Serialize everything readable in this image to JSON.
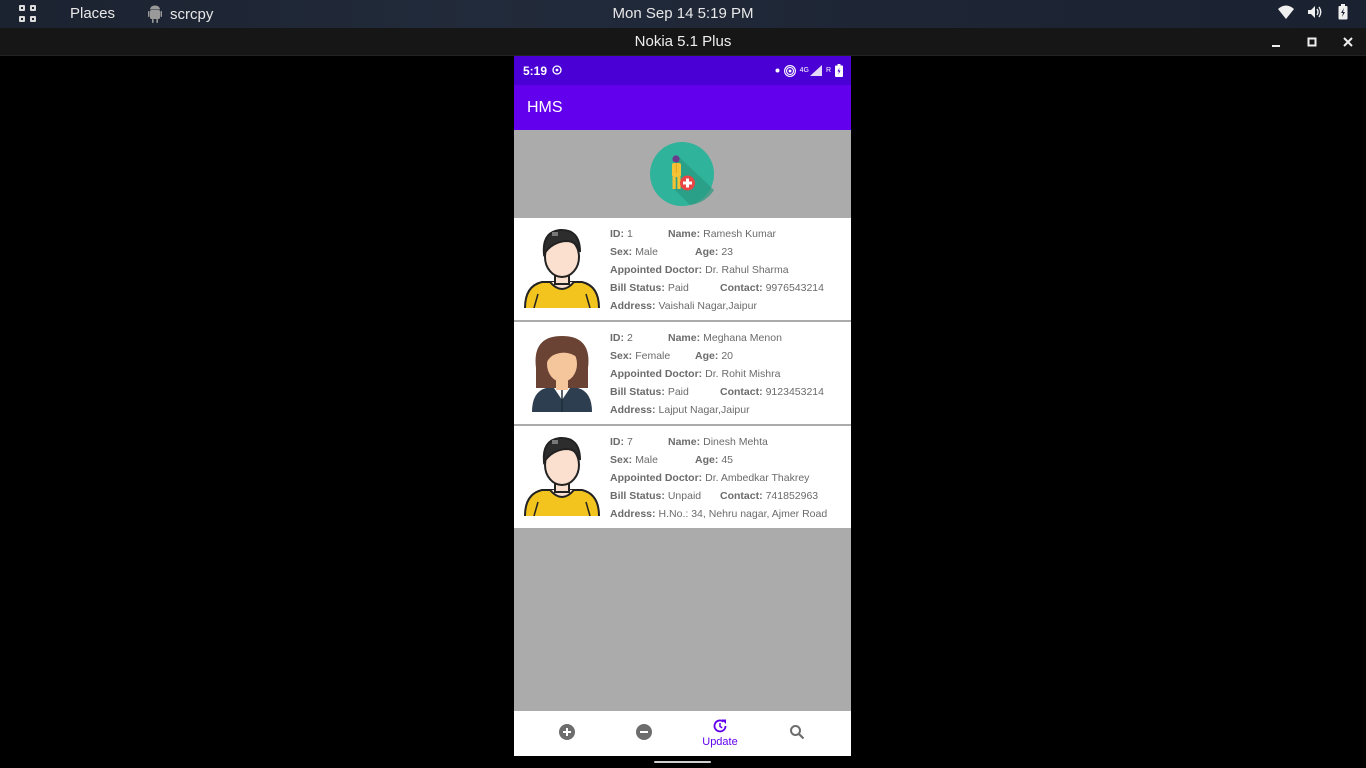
{
  "topbar": {
    "activities_icon": "apps-grid-icon",
    "places": "Places",
    "app_name": "scrcpy",
    "clock": "Mon Sep 14   5:19 PM",
    "tray_icons": [
      "wifi-icon",
      "volume-icon",
      "battery-icon"
    ]
  },
  "window": {
    "title": "Nokia 5.1 Plus",
    "buttons": [
      "minimize-icon",
      "maximize-icon",
      "close-icon"
    ]
  },
  "phone": {
    "status_time": "5:19",
    "status_network": "4G",
    "status_carrier": "R",
    "app_title": "HMS",
    "colors": {
      "status_bar": "#4a00d4",
      "app_bar": "#6200ee",
      "background": "#ababab",
      "accent": "#6200ee"
    }
  },
  "labels": {
    "id": "ID:",
    "name": "Name:",
    "sex": "Sex:",
    "age": "Age:",
    "doctor": "Appointed Doctor:",
    "bill": "Bill Status:",
    "contact": "Contact:",
    "address": "Address:"
  },
  "patients": [
    {
      "id": "1",
      "name": "Ramesh Kumar",
      "sex": "Male",
      "age": "23",
      "doctor": "Dr. Rahul Sharma",
      "bill": "Paid",
      "contact": "9976543214",
      "address": "Vaishali Nagar,Jaipur",
      "avatar": "male-avatar-icon"
    },
    {
      "id": "2",
      "name": "Meghana Menon",
      "sex": "Female",
      "age": "20",
      "doctor": "Dr. Rohit Mishra",
      "bill": "Paid",
      "contact": "9123453214",
      "address": "Lajput Nagar,Jaipur",
      "avatar": "female-avatar-icon"
    },
    {
      "id": "7",
      "name": "Dinesh Mehta",
      "sex": "Male",
      "age": "45",
      "doctor": "Dr. Ambedkar Thakrey",
      "bill": "Unpaid",
      "contact": "741852963",
      "address": "H.No.: 34, Nehru nagar, Ajmer Road",
      "avatar": "male-avatar-icon"
    }
  ],
  "bottom_nav": [
    {
      "icon": "add-circle-icon",
      "label": ""
    },
    {
      "icon": "remove-circle-icon",
      "label": ""
    },
    {
      "icon": "update-icon",
      "label": "Update",
      "active": true
    },
    {
      "icon": "search-icon",
      "label": ""
    }
  ]
}
